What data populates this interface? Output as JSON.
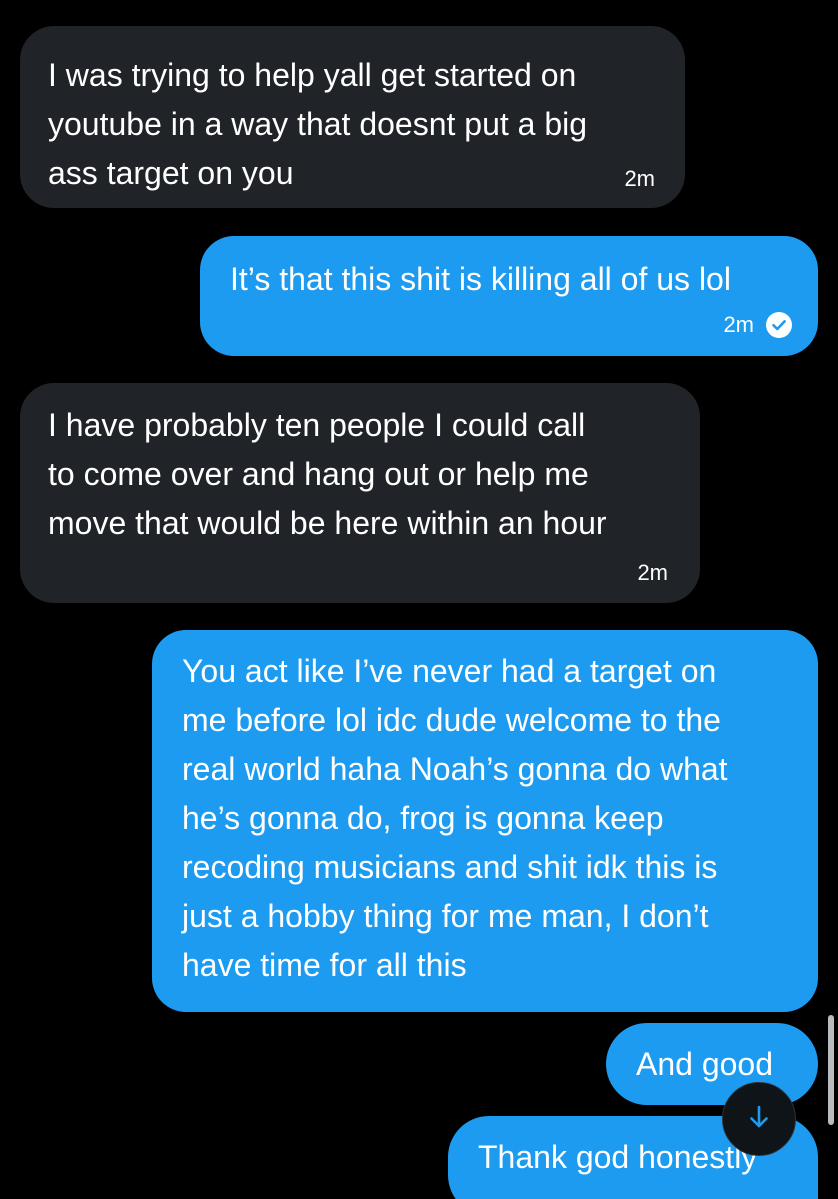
{
  "messages": [
    {
      "direction": "incoming",
      "lines": [
        "I was trying to help yall get started on",
        "youtube in a way that doesnt put a big",
        "ass target on you"
      ],
      "time": "2m"
    },
    {
      "direction": "outgoing",
      "lines": [
        "It’s that this shit is killing all of us lol"
      ],
      "time": "2m",
      "read_icon": "check-circle-icon"
    },
    {
      "direction": "incoming",
      "lines": [
        "I have probably ten people I could call",
        "to come over and hang out or help me",
        "move that would be here within an hour"
      ],
      "time": "2m"
    },
    {
      "direction": "outgoing",
      "lines": [
        "You act like I’ve never had a target on",
        "me before lol idc dude welcome to the",
        "real world haha Noah’s gonna do what",
        "he’s gonna do, frog is gonna keep",
        "recoding musicians and shit idk this is",
        "just a hobby thing for me man, I don’t",
        "have time for all this"
      ]
    },
    {
      "direction": "outgoing",
      "lines": [
        "And good"
      ]
    },
    {
      "direction": "outgoing",
      "lines": [
        "Thank god honestly"
      ]
    }
  ],
  "scroll_down_button": {
    "icon": "arrow-down-icon"
  },
  "colors": {
    "background": "#000000",
    "incoming_bubble": "#202327",
    "outgoing_bubble": "#1d9bf0",
    "text": "#ffffff"
  }
}
